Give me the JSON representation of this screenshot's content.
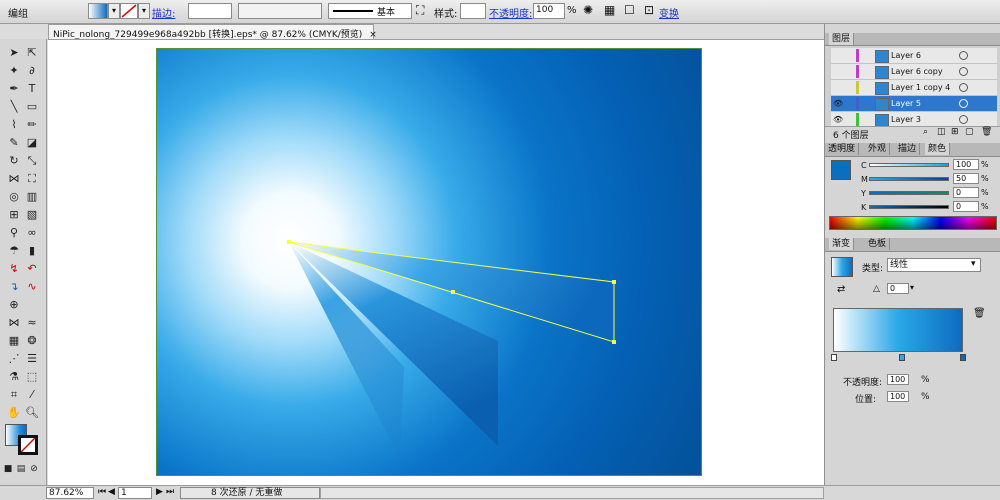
{
  "control_bar": {
    "selection_label": "编组",
    "stroke_label": "描边:",
    "line_style_label": "基本",
    "style_label": "样式:",
    "opacity_label": "不透明度:",
    "opacity_value": "100",
    "opacity_unit": "%",
    "transform_label": "变换"
  },
  "document": {
    "tab_title": "NiPic_nolong_729499e968a492bb [转换].eps* @ 87.62% (CMYK/预览)",
    "close_glyph": "×"
  },
  "status_bar": {
    "zoom": "87.62%",
    "page": "1",
    "status_text": "8 次还原 / 无重做"
  },
  "layers_panel": {
    "title": "图层",
    "count_label": "6 个图层",
    "layers": [
      {
        "name": "Layer 6",
        "color": "#c040c0",
        "visible": false,
        "selected": false
      },
      {
        "name": "Layer 6 copy",
        "color": "#c040c0",
        "visible": false,
        "selected": false
      },
      {
        "name": "Layer 1 copy 4",
        "color": "#c8c840",
        "visible": false,
        "selected": false
      },
      {
        "name": "Layer 5",
        "color": "#4060d0",
        "visible": true,
        "selected": true
      },
      {
        "name": "Layer 3",
        "color": "#40c040",
        "visible": true,
        "selected": false
      }
    ]
  },
  "color_panel": {
    "tabs": [
      "透明度",
      "外观",
      "描边",
      "颜色"
    ],
    "channels": [
      {
        "label": "C",
        "value": "100"
      },
      {
        "label": "M",
        "value": "50"
      },
      {
        "label": "Y",
        "value": "0"
      },
      {
        "label": "K",
        "value": "0"
      }
    ],
    "percent": "%",
    "swatch_color": "#0a6fc0"
  },
  "gradient_panel": {
    "tabs": [
      "渐变",
      "色板"
    ],
    "type_label": "类型:",
    "type_value": "线性",
    "angle_value": "0",
    "opacity_label": "不透明度:",
    "opacity_value": "100",
    "location_label": "位置:",
    "location_value": "100",
    "percent": "%",
    "stops": [
      "#ffffff",
      "#2aa8e8",
      "#0d6cc0"
    ]
  }
}
